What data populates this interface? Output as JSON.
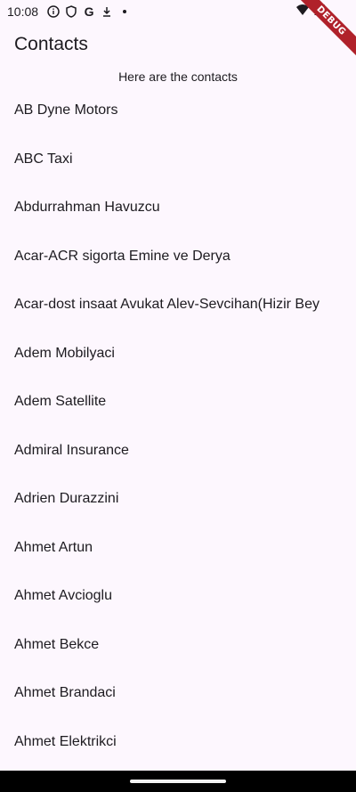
{
  "status_bar": {
    "time": "10:08",
    "icons": [
      "info-icon",
      "shield-icon",
      "google-icon",
      "download-icon",
      "dot-icon"
    ],
    "right_icons": [
      "wifi-icon",
      "signal-icon"
    ]
  },
  "debug_label": "DEBUG",
  "app_bar": {
    "title": "Contacts"
  },
  "subtitle": "Here are the contacts",
  "contacts": [
    "AB Dyne Motors",
    "ABC Taxi",
    "Abdurrahman Havuzcu",
    "Acar-ACR sigorta Emine ve Derya",
    "Acar-dost insaat Avukat Alev-Sevcihan(Hizir Bey",
    "Adem Mobilyaci",
    "Adem Satellite",
    "Admiral Insurance",
    "Adrien Durazzini",
    "Ahmet Artun",
    "Ahmet Avcioglu",
    "Ahmet Bekce",
    "Ahmet Brandaci",
    "Ahmet Elektrikci"
  ],
  "colors": {
    "background": "#fdf7fe",
    "text": "#1d1b20",
    "debug_ribbon": "#b0212a"
  }
}
